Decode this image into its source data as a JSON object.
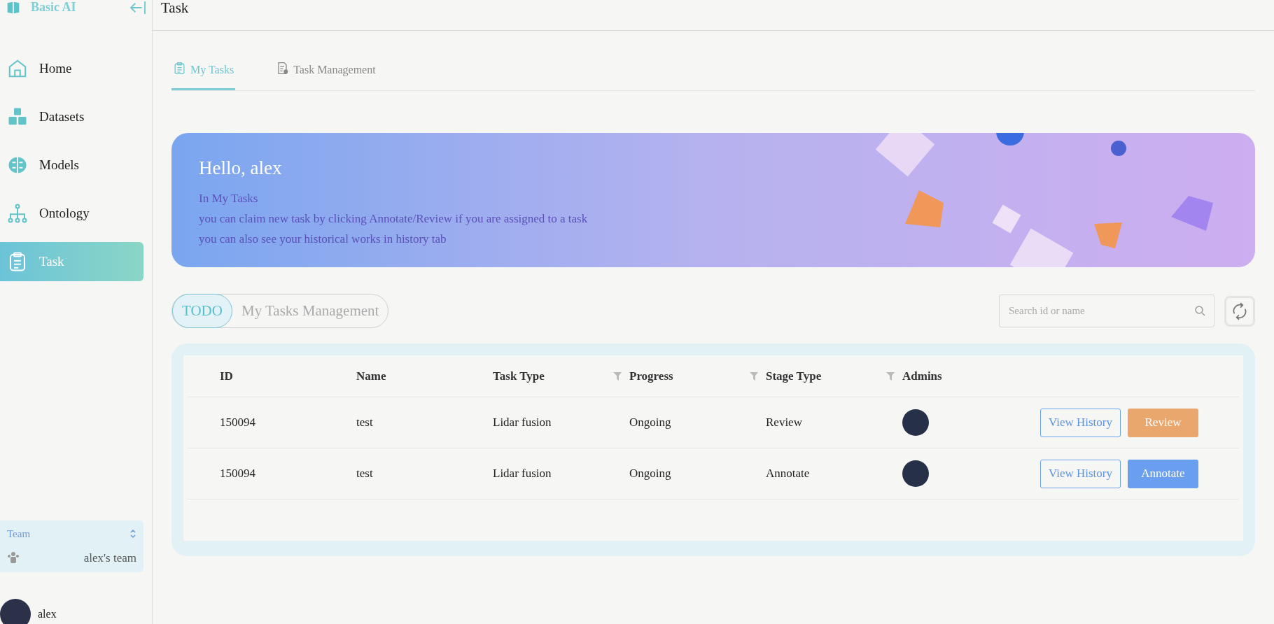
{
  "sidebar": {
    "brand": "Basic AI",
    "items": [
      {
        "label": "Home",
        "kind": "home",
        "selected": false
      },
      {
        "label": "Datasets",
        "kind": "cubes",
        "selected": false
      },
      {
        "label": "Models",
        "kind": "brain",
        "selected": false
      },
      {
        "label": "Ontology",
        "kind": "tree",
        "selected": false
      },
      {
        "label": "Task",
        "kind": "clipboard",
        "selected": true
      }
    ],
    "team": {
      "label": "Team",
      "name": "alex's team"
    },
    "user": "alex"
  },
  "header": {
    "title": "Task"
  },
  "tabs": [
    {
      "label": "My Tasks",
      "kind": "clipboard",
      "selected": true
    },
    {
      "label": "Task Management",
      "kind": "doc",
      "selected": false
    }
  ],
  "banner": {
    "title": "Hello, alex",
    "lines": [
      "In My Tasks",
      "you can claim new task by clicking Annotate/Review if you are assigned to a task",
      "you can also see your historical works in history tab"
    ]
  },
  "segments": [
    {
      "label": "TODO",
      "selected": true
    },
    {
      "label": "My Tasks Management",
      "selected": false
    }
  ],
  "search": {
    "placeholder": "Search id or name"
  },
  "table": {
    "columns": [
      {
        "label": "ID",
        "filter": false
      },
      {
        "label": "Name",
        "filter": false
      },
      {
        "label": "Task Type",
        "filter": true
      },
      {
        "label": "Progress",
        "filter": true
      },
      {
        "label": "Stage Type",
        "filter": true
      },
      {
        "label": "Admins",
        "filter": false
      }
    ],
    "rows": [
      {
        "cells": [
          "150094",
          "test",
          "Lidar fusion",
          "Ongoing",
          "Review"
        ],
        "history": "View History",
        "action": {
          "label": "Review",
          "kind": "review"
        }
      },
      {
        "cells": [
          "150094",
          "test",
          "Lidar fusion",
          "Ongoing",
          "Annotate"
        ],
        "history": "View History",
        "action": {
          "label": "Annotate",
          "kind": "annotate"
        }
      }
    ]
  }
}
